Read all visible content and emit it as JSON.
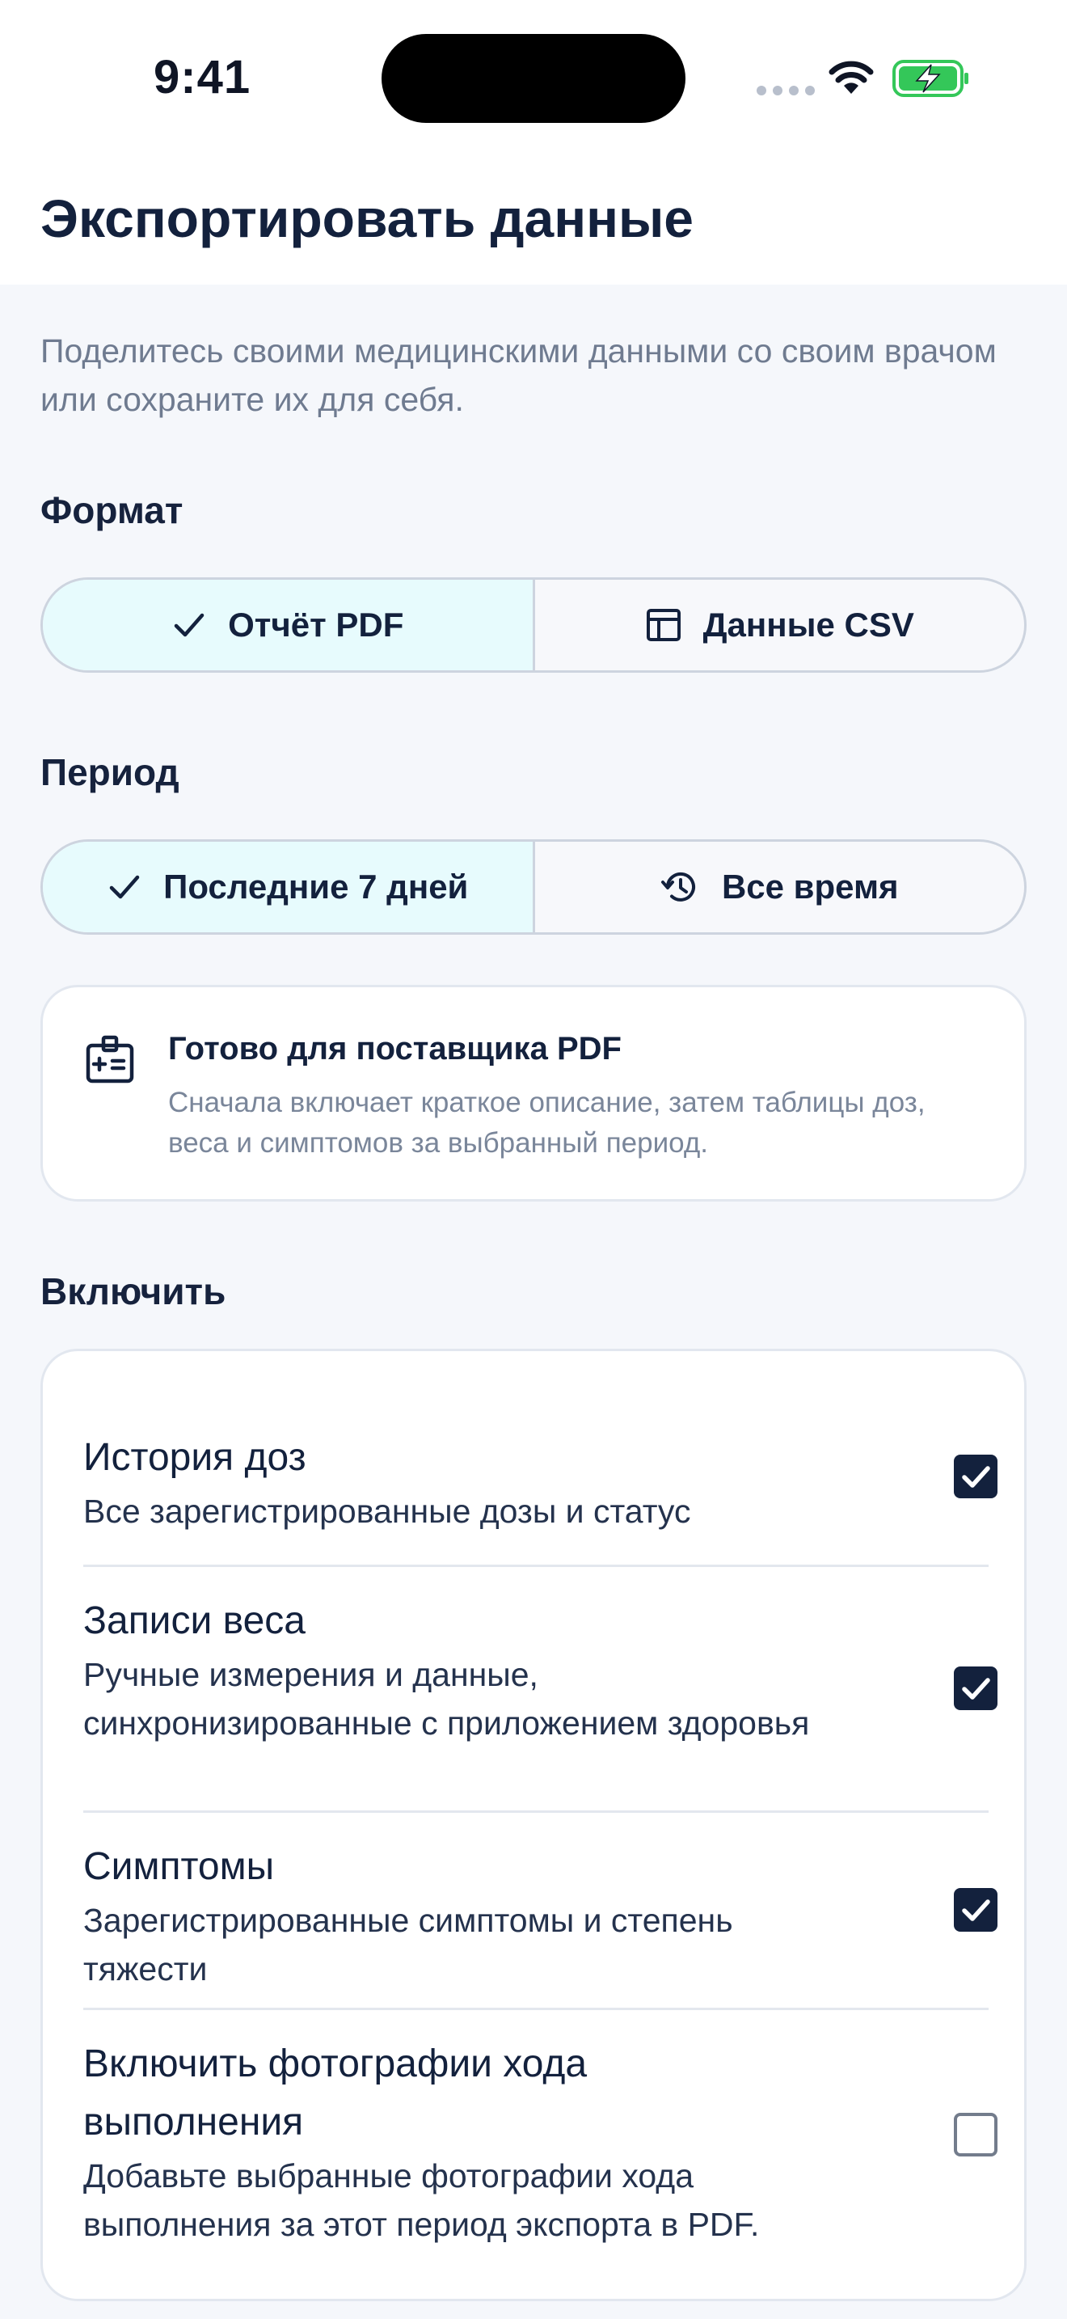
{
  "status_bar": {
    "time": "9:41"
  },
  "header": {
    "title": "Экспортировать данные"
  },
  "subtitle": "Поделитесь своими медицинскими данными со своим врачом или сохраните их для себя.",
  "format": {
    "label": "Формат",
    "options": [
      {
        "label": "Отчёт PDF",
        "icon": "checkmark-icon",
        "selected": true
      },
      {
        "label": "Данные CSV",
        "icon": "table-icon",
        "selected": false
      }
    ]
  },
  "period": {
    "label": "Период",
    "options": [
      {
        "label": "Последние 7 дней",
        "icon": "checkmark-icon",
        "selected": true
      },
      {
        "label": "Все время",
        "icon": "history-icon",
        "selected": false
      }
    ]
  },
  "info": {
    "icon": "medical-id-icon",
    "title": "Готово для поставщика PDF",
    "description": "Сначала включает краткое описание, затем таблицы доз, веса и симптомов за выбранный период."
  },
  "include": {
    "label": "Включить",
    "items": [
      {
        "title": "История доз",
        "description": "Все зарегистрированные дозы и статус",
        "checked": true
      },
      {
        "title": "Записи веса",
        "description": "Ручные измерения и данные, синхронизированные с приложением здоровья",
        "checked": true
      },
      {
        "title": "Симптомы",
        "description": "Зарегистрированные симптомы и степень тяжести",
        "checked": true
      },
      {
        "title": "Включить фотографии хода выполнения",
        "description": "Добавьте выбранные фотографии хода выполнения за этот период экспорта в PDF.",
        "checked": false
      }
    ]
  },
  "colors": {
    "accent": "#13213d",
    "selected_bg": "#e7fbfd",
    "background": "#f5f7fb",
    "battery": "#34c759"
  }
}
